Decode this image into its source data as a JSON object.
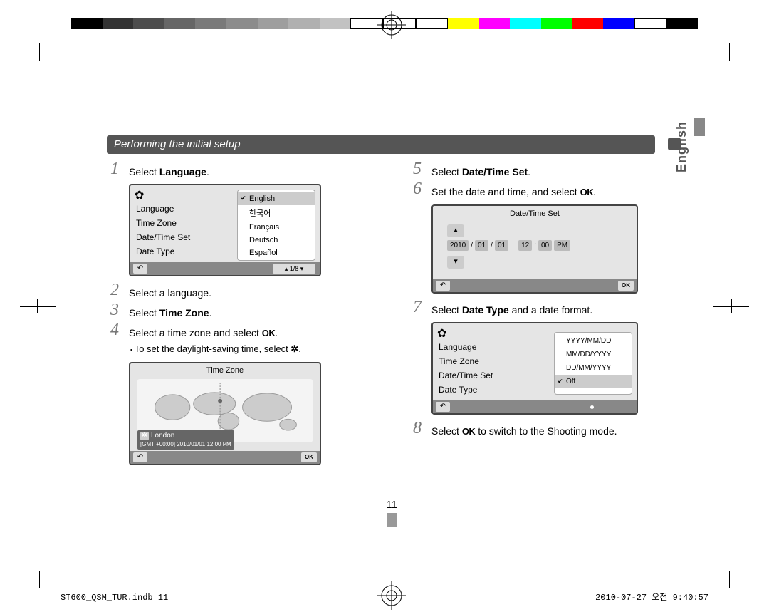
{
  "colorbar": [
    "#000000",
    "#333333",
    "#4d4d4d",
    "#666666",
    "#7a7a7a",
    "#8c8c8c",
    "#9e9e9e",
    "#b0b0b0",
    "#c2c2c2",
    "#ffffff",
    "#ffffff",
    "#ffffff",
    "#ffff00",
    "#ff00ff",
    "#00ffff",
    "#00ff00",
    "#ff0000",
    "#0000ff",
    "#ffffff",
    "#000000"
  ],
  "lang_tab": "English",
  "heading": "Performing the initial setup",
  "steps": {
    "s1_pre": "Select ",
    "s1_bold": "Language",
    "s1_post": ".",
    "s2": "Select a language.",
    "s3_pre": "Select ",
    "s3_bold": "Time Zone",
    "s3_post": ".",
    "s4_pre": "Select a time zone and select ",
    "s4_ok": "OK",
    "s4_post": ".",
    "s4_sub_pre": "To set the daylight-saving time, select ",
    "s4_sub_icon": "✲",
    "s4_sub_post": ".",
    "s5_pre": "Select ",
    "s5_bold": "Date/Time Set",
    "s5_post": ".",
    "s6_pre": "Set the date and time, and select ",
    "s6_ok": "OK",
    "s6_post": ".",
    "s7_pre": "Select ",
    "s7_bold": "Date Type",
    "s7_post": " and a date format.",
    "s8_pre": "Select ",
    "s8_ok": "OK",
    "s8_post": " to switch to the Shooting mode."
  },
  "screen1": {
    "menu": [
      "Language",
      "Time Zone",
      "Date/Time Set",
      "Date Type"
    ],
    "options": [
      "English",
      "한국어",
      "Français",
      "Deutsch",
      "Español"
    ],
    "pager": "1/8"
  },
  "screen2": {
    "title": "Time Zone",
    "city": "London",
    "gmt": "[GMT +00:00] 2010/01/01 12:00 PM",
    "ok": "OK"
  },
  "screen3": {
    "title": "Date/Time Set",
    "year": "2010",
    "m": "01",
    "d": "01",
    "hh": "12",
    "mm": "00",
    "ampm": "PM",
    "ok": "OK"
  },
  "screen4": {
    "menu": [
      "Language",
      "Time Zone",
      "Date/Time Set",
      "Date Type"
    ],
    "options": [
      "YYYY/MM/DD",
      "MM/DD/YYYY",
      "DD/MM/YYYY",
      "Off"
    ]
  },
  "page_number": "11",
  "footer_left": "ST600_QSM_TUR.indb   11",
  "footer_right": "2010-07-27   오전 9:40:57"
}
